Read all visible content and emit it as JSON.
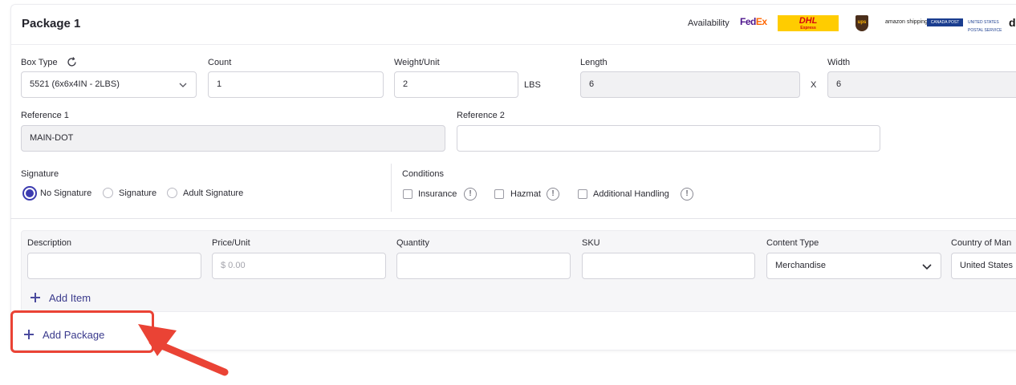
{
  "header": {
    "title": "Package 1",
    "availability_label": "Availability",
    "carriers": {
      "fedex_fe": "Fed",
      "fedex_ex": "Ex",
      "dhl": "DHL",
      "dhl_sub": "Express",
      "ups": "ups",
      "amazon": "amazon shipping",
      "canadapost": "CANADA POST",
      "usps": "UNITED STATES POSTAL SERVICE",
      "tiktok": "d"
    }
  },
  "package": {
    "box_type": {
      "label": "Box Type",
      "value": "5521 (6x6x4IN - 2LBS)"
    },
    "count": {
      "label": "Count",
      "value": "1"
    },
    "weight": {
      "label": "Weight/Unit",
      "value": "2",
      "unit": "LBS"
    },
    "length": {
      "label": "Length",
      "value": "6"
    },
    "x_sep": "X",
    "width": {
      "label": "Width",
      "value": "6"
    },
    "reference1": {
      "label": "Reference 1",
      "value": "MAIN-DOT"
    },
    "reference2": {
      "label": "Reference 2",
      "value": ""
    }
  },
  "signature": {
    "label": "Signature",
    "options": [
      "No Signature",
      "Signature",
      "Adult Signature"
    ],
    "selected": "No Signature"
  },
  "conditions": {
    "label": "Conditions",
    "options": [
      "Insurance",
      "Hazmat",
      "Additional Handling"
    ]
  },
  "items": {
    "columns": [
      "Description",
      "Price/Unit",
      "Quantity",
      "SKU",
      "Content Type",
      "Country of Man"
    ],
    "price_placeholder": "$  0.00",
    "content_type_value": "Merchandise",
    "country_value": "United States",
    "add_item_label": "Add Item"
  },
  "footer": {
    "add_package_label": "Add Package"
  },
  "colors": {
    "accent": "#3c3bb0",
    "highlight": "#ea4335"
  }
}
